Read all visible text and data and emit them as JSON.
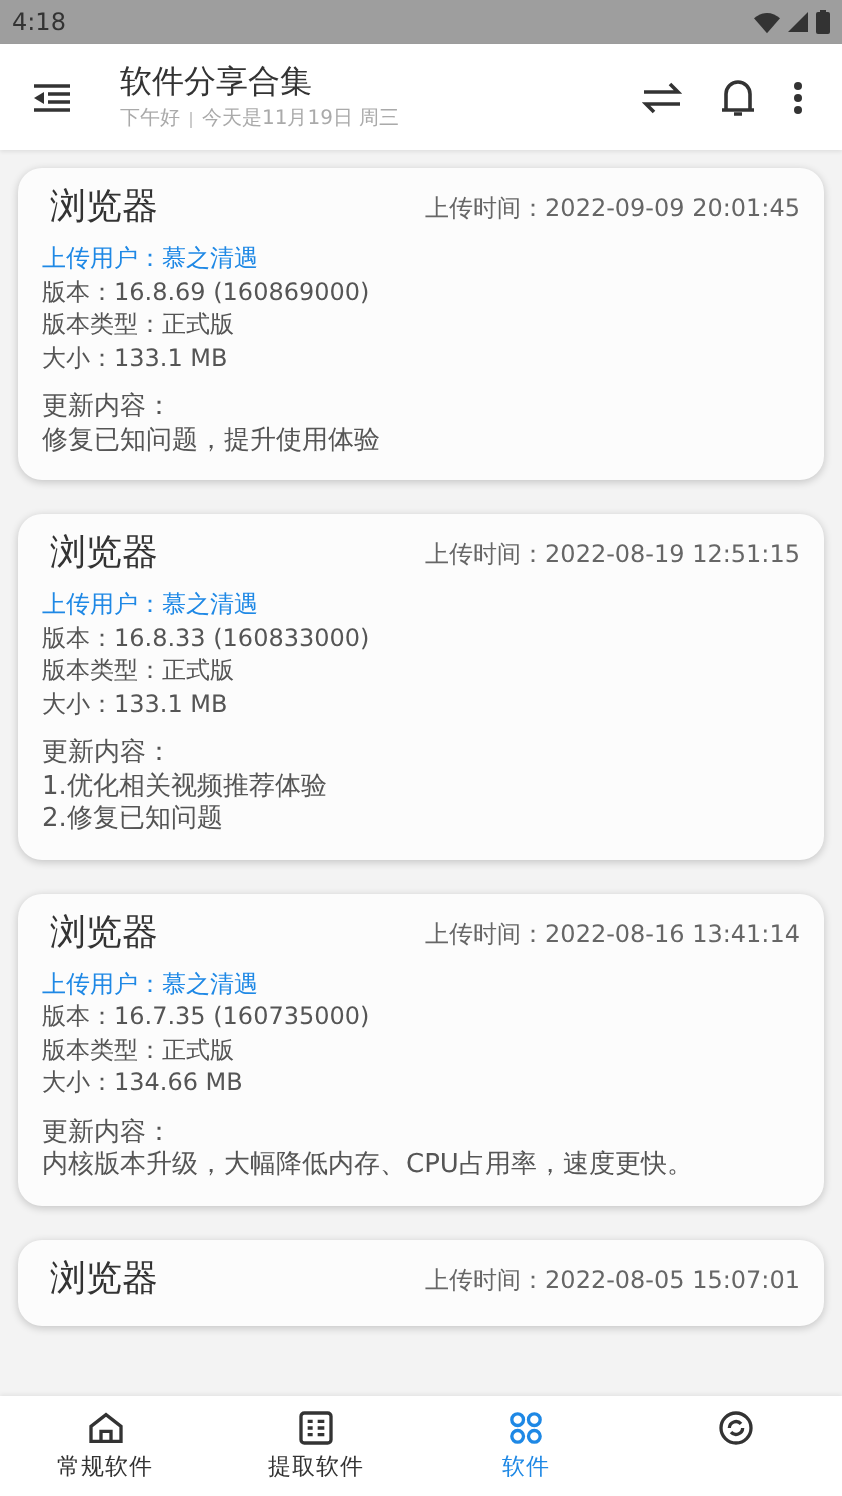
{
  "status_bar": {
    "time": "4:18"
  },
  "header": {
    "title": "软件分享合集",
    "greeting": "下午好",
    "date": "今天是11月19日 周三"
  },
  "cards": [
    {
      "name": "浏览器",
      "upload_time": "上传时间：2022-09-09 20:01:45",
      "uploader": "上传用户：慕之清遇",
      "version": "版本：16.8.69 (160869000)",
      "version_type": "版本类型：正式版",
      "size": "大小：133.1 MB",
      "changelog_title": "更新内容：",
      "changelog": [
        "修复已知问题，提升使用体验"
      ]
    },
    {
      "name": "浏览器",
      "upload_time": "上传时间：2022-08-19 12:51:15",
      "uploader": "上传用户：慕之清遇",
      "version": "版本：16.8.33 (160833000)",
      "version_type": "版本类型：正式版",
      "size": "大小：133.1 MB",
      "changelog_title": "更新内容：",
      "changelog": [
        "1.优化相关视频推荐体验",
        "2.修复已知问题"
      ]
    },
    {
      "name": "浏览器",
      "upload_time": "上传时间：2022-08-16 13:41:14",
      "uploader": "上传用户：慕之清遇",
      "version": "版本：16.7.35 (160735000)",
      "version_type": "版本类型：正式版",
      "size": "大小：134.66 MB",
      "changelog_title": "更新内容：",
      "changelog": [
        "内核版本升级，大幅降低内存、CPU占用率，速度更快。"
      ]
    },
    {
      "name": "浏览器",
      "upload_time": "上传时间：2022-08-05 15:07:01"
    }
  ],
  "bottom_nav": [
    {
      "kind": "home",
      "label": "常规软件",
      "selected": false
    },
    {
      "kind": "list",
      "label": "提取软件",
      "selected": false
    },
    {
      "kind": "grid",
      "label": "软件",
      "selected": true
    },
    {
      "kind": "refresh",
      "selected": false
    }
  ]
}
